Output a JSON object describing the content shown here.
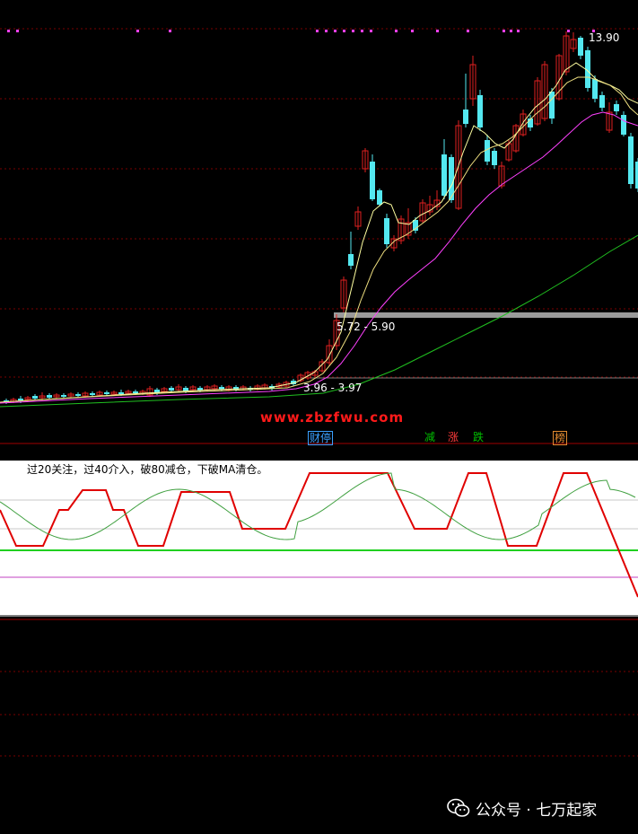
{
  "chart_data": {
    "type": "candlestick",
    "price_labels": {
      "high_label": "13.90",
      "band_upper": "5.72 - 5.90",
      "band_lower": "3.96 - 3.97"
    },
    "event_tags": [
      {
        "label": "财停",
        "color": "#3aa0ff"
      },
      {
        "label": "减",
        "color": "#00c000"
      },
      {
        "label": "涨",
        "color": "#ff3b3b"
      },
      {
        "label": "跌",
        "color": "#00c000"
      },
      {
        "label": "榜",
        "color": "#e08a30"
      }
    ],
    "indicator": {
      "formula_text": "过20关注，过40介入，破80减仓，下破MA清仓。",
      "levels": [
        20,
        40,
        80
      ]
    },
    "colors": {
      "up": "#e02020",
      "down": "#54e8f0",
      "ma_short": "#ffffa0",
      "ma_mid": "#ff40ff",
      "ma_long": "#20c020"
    }
  },
  "watermark": "www.zbzfwu.com",
  "footer": {
    "account": "公众号 · 七万起家"
  }
}
